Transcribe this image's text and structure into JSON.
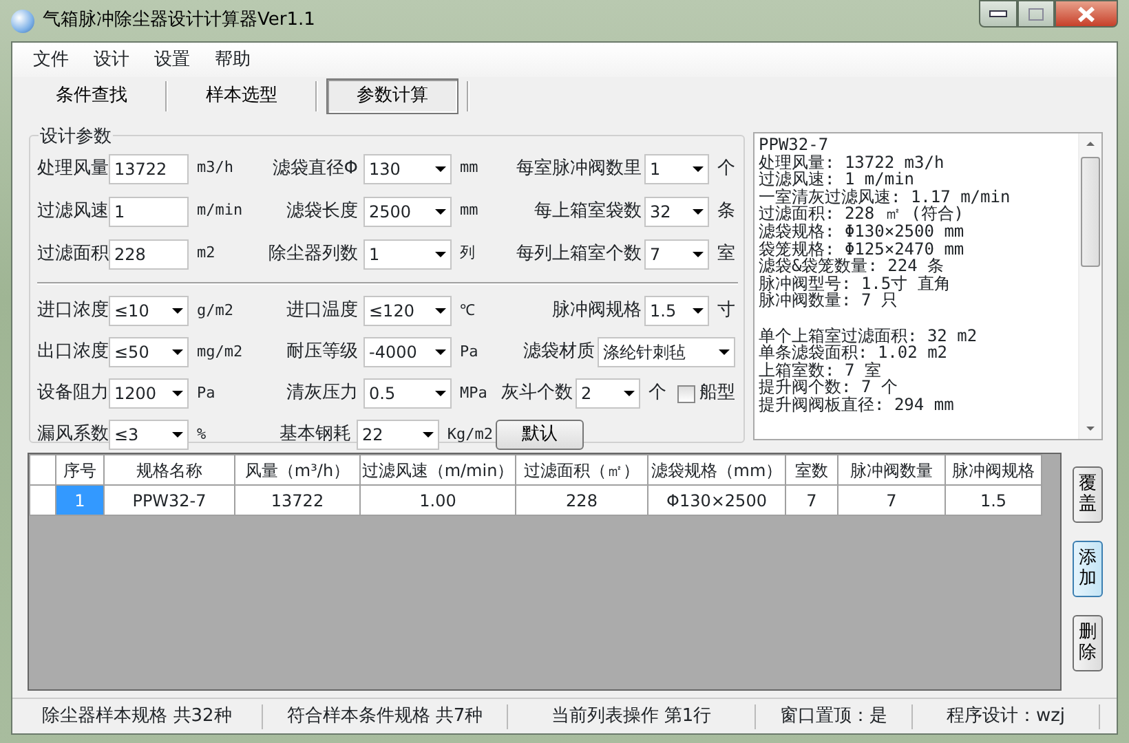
{
  "window": {
    "title": "气箱脉冲除尘器设计计算器Ver1.1"
  },
  "menu": [
    "文件",
    "设计",
    "设置",
    "帮助"
  ],
  "tabs": [
    {
      "label": "条件查找",
      "selected": false
    },
    {
      "label": "样本选型",
      "selected": false
    },
    {
      "label": "参数计算",
      "selected": true
    }
  ],
  "params": {
    "title": "设计参数",
    "top_rows": [
      [
        {
          "kind": "text",
          "label": "处理风量",
          "value": "13722",
          "unit": "m3/h"
        },
        {
          "kind": "select",
          "label": "滤袋直径Φ",
          "value": "130",
          "unit": "mm"
        },
        {
          "kind": "select",
          "label": "每室脉冲阀数里",
          "value": "1",
          "unit": "个"
        }
      ],
      [
        {
          "kind": "text",
          "label": "过滤风速",
          "value": "1",
          "unit": "m/min"
        },
        {
          "kind": "select",
          "label": "滤袋长度",
          "value": "2500",
          "unit": "mm"
        },
        {
          "kind": "select",
          "label": "每上箱室袋数",
          "value": "32",
          "unit": "条"
        }
      ],
      [
        {
          "kind": "text",
          "label": "过滤面积",
          "value": "228",
          "unit": "m2"
        },
        {
          "kind": "select",
          "label": "除尘器列数",
          "value": "1",
          "unit": "列"
        },
        {
          "kind": "select",
          "label": "每列上箱室个数",
          "value": "7",
          "unit": "室"
        }
      ]
    ],
    "bottom_rows": [
      [
        {
          "kind": "select",
          "label": "进口浓度",
          "value": "≤10",
          "unit": "g/m2"
        },
        {
          "kind": "select",
          "label": "进口温度",
          "value": "≤120",
          "unit": "℃"
        },
        {
          "kind": "select",
          "label": "脉冲阀规格",
          "value": "1.5",
          "unit": "寸"
        }
      ],
      [
        {
          "kind": "select",
          "label": "出口浓度",
          "value": "≤50",
          "unit": "mg/m2"
        },
        {
          "kind": "select",
          "label": "耐压等级",
          "value": "-4000",
          "unit": "Pa"
        },
        {
          "kind": "select",
          "label": "滤袋材质",
          "value": "涤纶针刺毡"
        }
      ],
      [
        {
          "kind": "select",
          "label": "设备阻力",
          "value": "1200",
          "unit": "Pa"
        },
        {
          "kind": "select",
          "label": "清灰压力",
          "value": "0.5",
          "unit": "MPa"
        },
        {
          "kind": "select_check",
          "label": "灰斗个数",
          "value": "2",
          "unit": "个",
          "check_label": "船型",
          "checked": false
        }
      ],
      [
        {
          "kind": "select",
          "label": "漏风系数",
          "value": "≤3",
          "unit": "%"
        },
        {
          "kind": "select",
          "label": "基本钢耗",
          "value": "22",
          "unit": "Kg/m2"
        },
        {
          "kind": "button",
          "label": "默认"
        }
      ]
    ]
  },
  "result": {
    "paragraphs": [
      [
        "PPW32-7",
        "处理风量: 13722 m3/h",
        "过滤风速: 1 m/min",
        "一室清灰过滤风速: 1.17 m/min",
        "过滤面积: 228 ㎡ (符合)",
        "滤袋规格: Φ130×2500 mm",
        "袋笼规格: Φ125×2470 mm",
        "滤袋&袋笼数量: 224 条",
        "脉冲阀型号: 1.5寸 直角",
        "脉冲阀数量: 7 只"
      ],
      [
        "单个上箱室过滤面积: 32 m2",
        "单条滤袋面积: 1.02 m2",
        "上箱室数: 7 室",
        "提升阀个数: 7 个",
        "提升阀阀板直径: 294 mm"
      ]
    ]
  },
  "table": {
    "columns": [
      "序号",
      "规格名称",
      "风量（m³/h）",
      "过滤风速（m/min）",
      "过滤面积（㎡）",
      "滤袋规格（mm）",
      "室数",
      "脉冲阀数量",
      "脉冲阀规格"
    ],
    "rows": [
      {
        "selected": true,
        "cells": [
          "1",
          "PPW32-7",
          "13722",
          "1.00",
          "228",
          "Φ130×2500",
          "7",
          "7",
          "1.5"
        ]
      }
    ]
  },
  "side_buttons": [
    {
      "label": "覆盖",
      "focused": false
    },
    {
      "label": "添加",
      "focused": true
    },
    {
      "label": "删除",
      "focused": false
    }
  ],
  "status_bar": [
    "除尘器样本规格 共32种",
    "符合样本条件规格 共7种",
    "当前列表操作 第1行",
    "窗口置顶：是",
    "程序设计：wzj"
  ]
}
